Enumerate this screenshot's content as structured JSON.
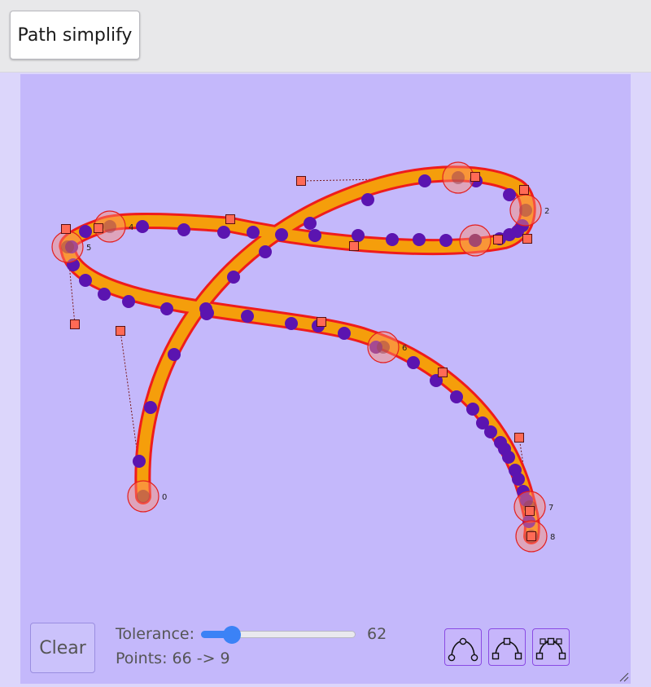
{
  "header": {
    "button_label": "Path simplify"
  },
  "controls": {
    "clear_label": "Clear",
    "tolerance_label": "Tolerance:",
    "tolerance_value": "62",
    "tolerance_fraction": 0.2,
    "points_text": "Points: 66 -> 9"
  },
  "colors": {
    "canvas_bg": "#c4b8fb",
    "path_fill": "#f59e0b",
    "path_outline": "#ef1c1c",
    "input_point": "#5b14b0",
    "anchor_fill": "rgba(255,140,110,0.45)",
    "handle_fill": "#ff6a55",
    "accent": "#3b82f6"
  },
  "anchor_labels": [
    "0",
    "2",
    "4",
    "5",
    "6",
    "7",
    "8"
  ],
  "mode_buttons": [
    "smooth-curve-icon",
    "corner-curve-icon",
    "handles-curve-icon"
  ]
}
